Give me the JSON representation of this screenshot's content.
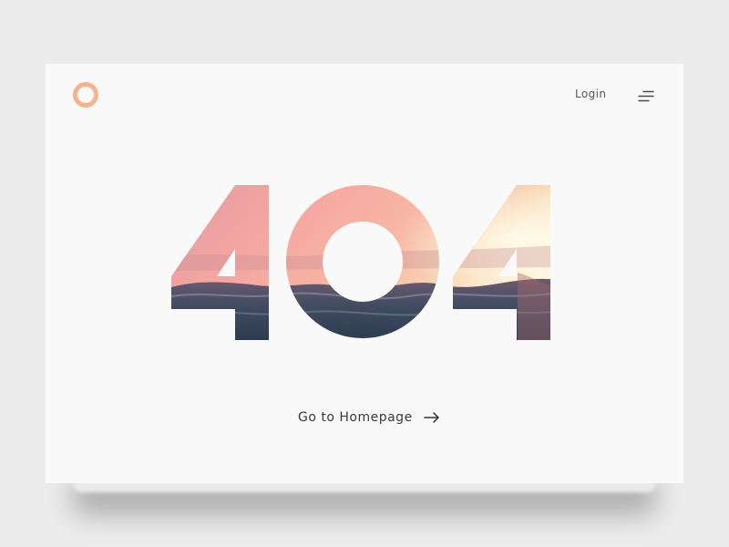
{
  "header": {
    "login_label": "Login",
    "logo_icon": "ring-logo-icon",
    "menu_icon": "menu-lines-icon"
  },
  "hero": {
    "error_code": "404",
    "image_fill": "sunset-ocean-waves"
  },
  "cta": {
    "label": "Go to Homepage",
    "icon": "arrow-right-icon"
  },
  "colors": {
    "page_background": "#ececec",
    "card_background": "#f9f9f9",
    "logo_accent": "#f6b48a",
    "text": "#3a3a3a"
  }
}
